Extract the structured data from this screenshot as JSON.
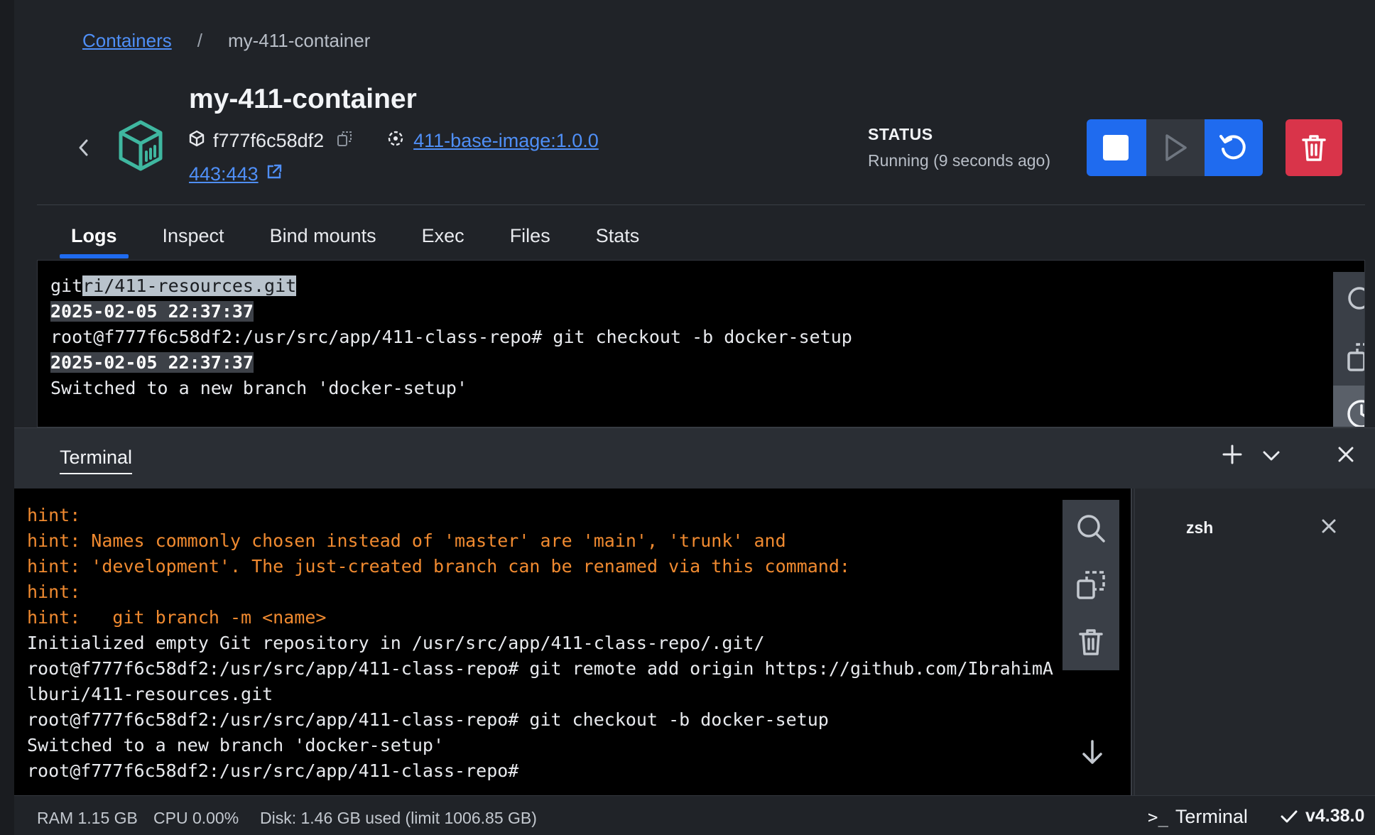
{
  "breadcrumb": {
    "parent": "Containers",
    "separator": "/",
    "current": "my-411-container"
  },
  "container": {
    "name": "my-411-container",
    "id": "f777f6c58df2",
    "image": "411-base-image:1.0.0",
    "port": "443:443"
  },
  "status": {
    "label": "STATUS",
    "value": "Running (9 seconds ago)"
  },
  "colors": {
    "accent": "#1f6bef",
    "danger": "#d9344a",
    "link": "#4f8ff7",
    "hint": "#f08a30",
    "container_icon": "#3fb7a0"
  },
  "tabs": [
    {
      "label": "Logs",
      "active": true
    },
    {
      "label": "Inspect"
    },
    {
      "label": "Bind mounts"
    },
    {
      "label": "Exec"
    },
    {
      "label": "Files"
    },
    {
      "label": "Stats"
    }
  ],
  "logs": {
    "line0_pre": "git",
    "line0_sel": "ri/411-resources.git",
    "ts1": "2025-02-05 22:37:37",
    "line2": "root@f777f6c58df2:/usr/src/app/411-class-repo# git checkout -b docker-setup",
    "ts2": "2025-02-05 22:37:37",
    "line4": "Switched to a new branch 'docker-setup'",
    "tool_icons": [
      "search-icon",
      "copy-icon",
      "clock-icon"
    ]
  },
  "terminal": {
    "title": "Terminal",
    "lines": [
      "hint:",
      "hint: Names commonly chosen instead of 'master' are 'main', 'trunk' and",
      "hint: 'development'. The just-created branch can be renamed via this command:",
      "hint:",
      "hint:   git branch -m <name>",
      "Initialized empty Git repository in /usr/src/app/411-class-repo/.git/",
      "root@f777f6c58df2:/usr/src/app/411-class-repo# git remote add origin https://github.com/IbrahimA",
      "lburi/411-resources.git",
      "root@f777f6c58df2:/usr/src/app/411-class-repo# git checkout -b docker-setup",
      "Switched to a new branch 'docker-setup'",
      "root@f777f6c58df2:/usr/src/app/411-class-repo#"
    ],
    "sessions": [
      {
        "name": "zsh"
      }
    ]
  },
  "footer": {
    "ram": "RAM 1.15 GB",
    "cpu": "CPU 0.00%",
    "disk": "Disk: 1.46 GB used (limit 1006.85 GB)",
    "terminal_label": "Terminal",
    "terminal_prompt": ">_",
    "version": "v4.38.0"
  }
}
